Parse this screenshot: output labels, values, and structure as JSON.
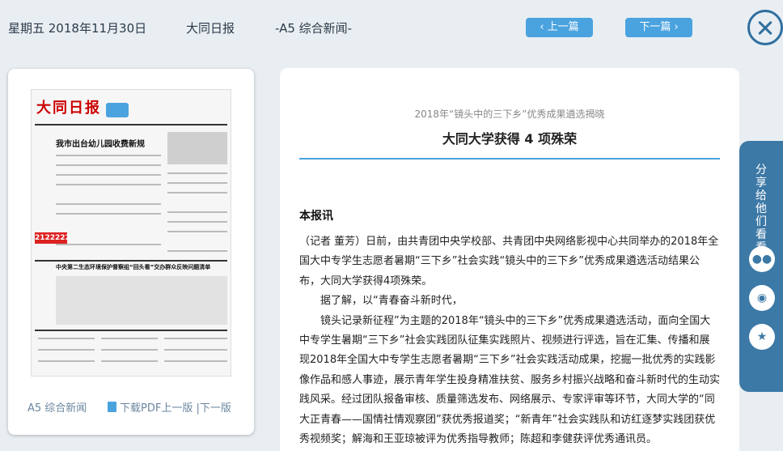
{
  "header": {
    "date": "星期五 2018年11月30日",
    "paper": "大同日报",
    "section": "-A5 综合新闻-",
    "prev_label": "上一篇",
    "next_label": "下一篇"
  },
  "left_panel": {
    "newspaper_thumb": {
      "masthead": "大同日报",
      "headline_1": "我市出台幼儿园收费新规",
      "headline_2": "中央第二生态环境保护督察组“回头看”交办群众反映问题清单",
      "badge": "2122222"
    },
    "section_label": "A5 综合新闻",
    "pdf_link": "下载PDF",
    "prev_page": "上一版",
    "separator": "|",
    "next_page": "下一版"
  },
  "article": {
    "subtitle": "2018年“镜头中的三下乡”优秀成果遴选揭晓",
    "title": "大同大学获得 4 项殊荣",
    "lead": "本报讯",
    "paragraphs": [
      "（记者 董芳）日前，由共青团中央学校部、共青团中央网络影视中心共同举办的2018年全国大中专学生志愿者暑期“三下乡”社会实践“镜头中的三下乡”优秀成果遴选活动结果公布，大同大学获得4项殊荣。",
      "据了解，以“青春奋斗新时代，",
      "镜头记录新征程”为主题的2018年“镜头中的三下乡”优秀成果遴选活动，面向全国大中专学生暑期“三下乡”社会实践团队征集实践照片、视频进行评选，旨在汇集、传播和展现2018年全国大中专学生志愿者暑期“三下乡”社会实践活动成果，挖掘一批优秀的实践影像作品和感人事迹，展示青年学生投身精准扶贫、服务乡村振兴战略和奋斗新时代的生动实践风采。经过团队报备审核、质量筛选发布、网络展示、专家评审等环节，大同大学的“同大正青春——国情社情观察团”获优秀报道奖；“新青年”社会实践队和访红逐梦实践团获优秀视频奖；解海和王亚琼被评为优秀指导教师；陈超和李健获评优秀通讯员。"
    ]
  },
  "share": {
    "label": "分享给他们看看",
    "icons": [
      "wechat-icon",
      "weibo-icon",
      "qzone-icon"
    ]
  },
  "colors": {
    "accent": "#4aa3df",
    "share_bg": "#3d79a6",
    "background": "#e9eef2"
  }
}
